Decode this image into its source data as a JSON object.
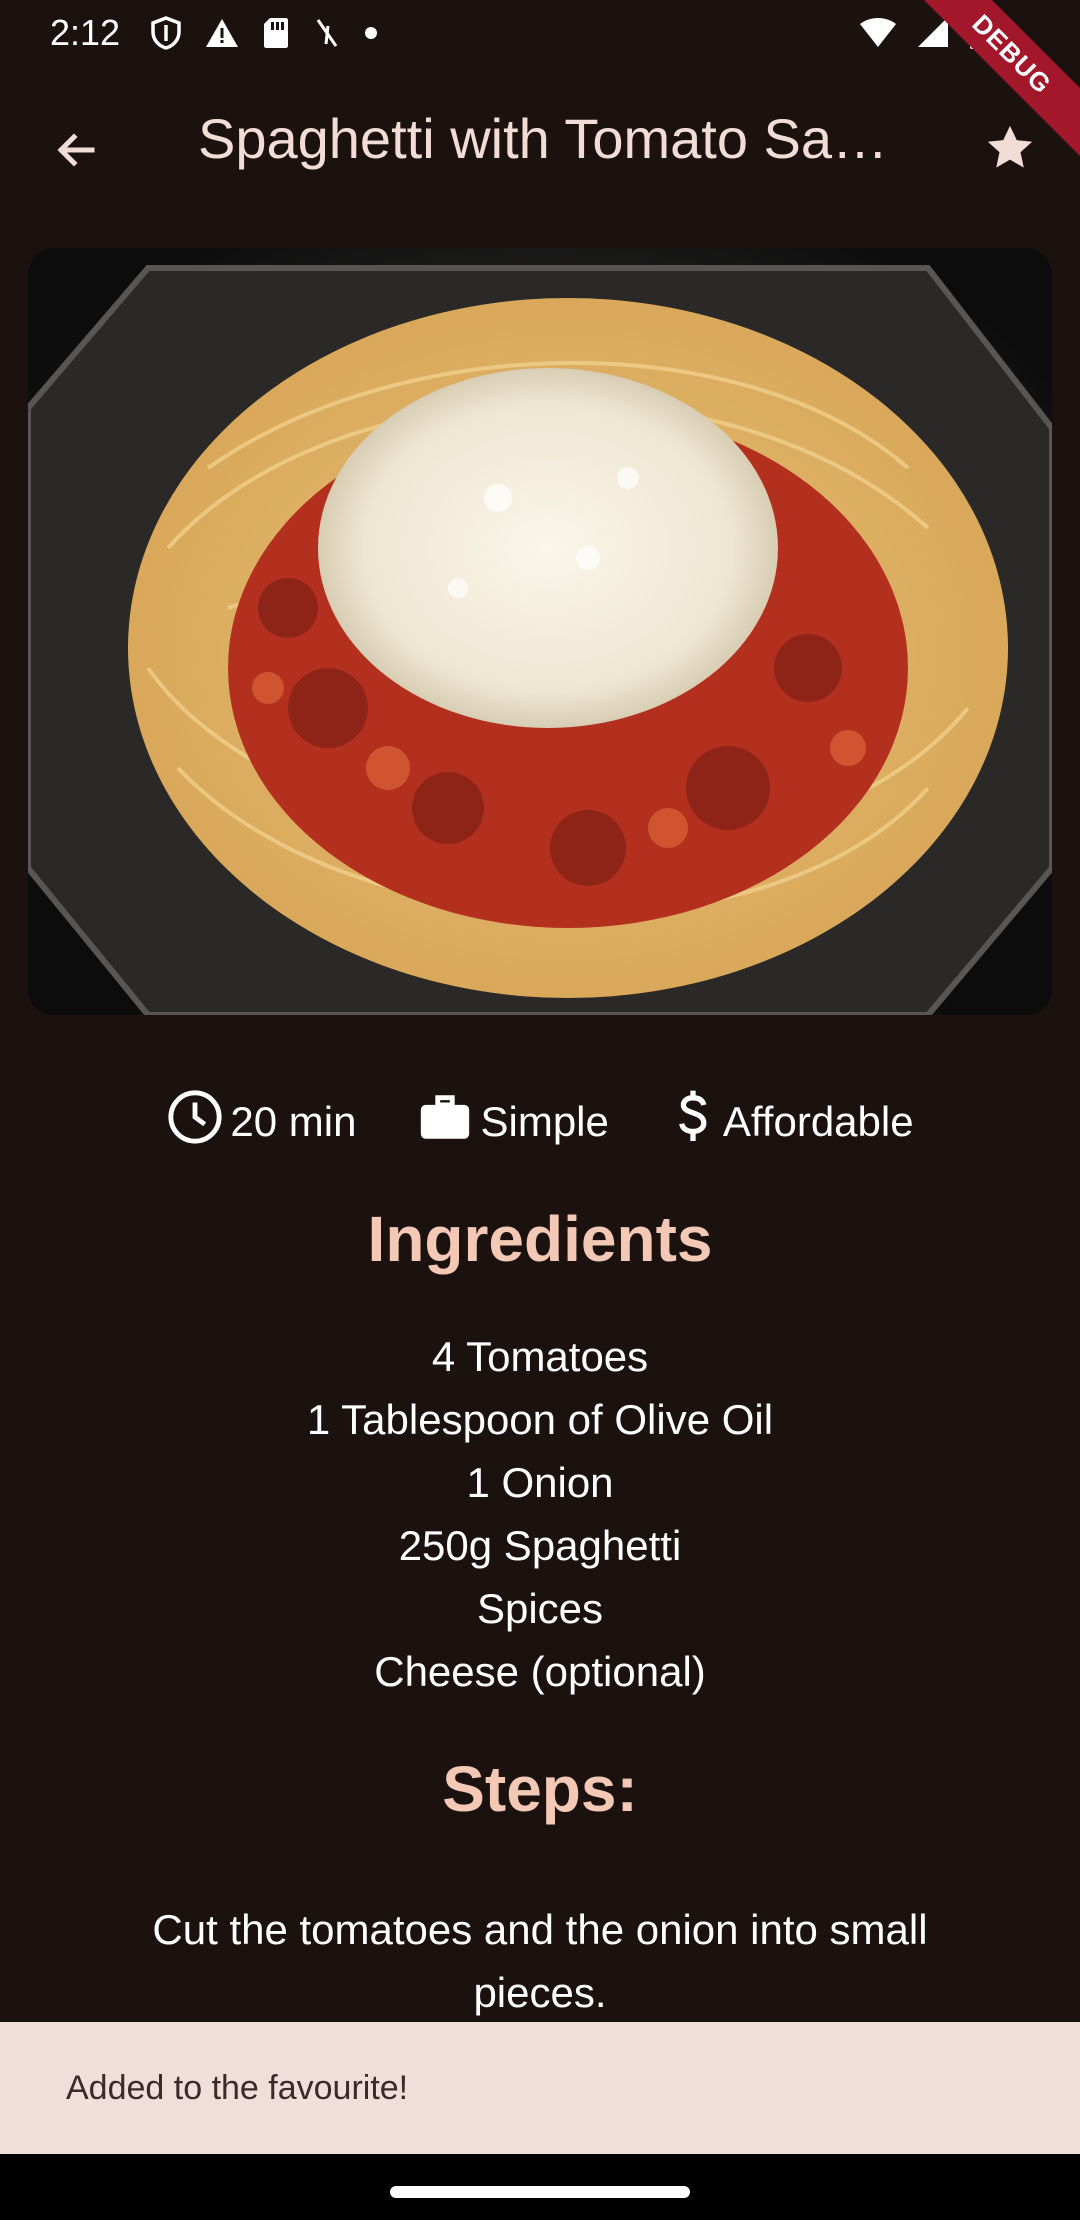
{
  "status_bar": {
    "time": "2:12",
    "left_icons": [
      "shield-icon",
      "warning-icon",
      "sim-card-icon",
      "signal-slash-icon",
      "dot-icon"
    ],
    "right_icons": [
      "wifi-icon",
      "cell-signal-icon",
      "battery-icon"
    ]
  },
  "debug_banner": "DEBUG",
  "app_bar": {
    "title": "Spaghetti with Tomato Sauce",
    "back_icon": "arrow-back-icon",
    "favorite_icon": "star-icon"
  },
  "recipe": {
    "image_subject": "Plate of spaghetti with tomato sauce and grated cheese",
    "duration": "20 min",
    "complexity": "Simple",
    "affordability": "Affordable",
    "ingredients_title": "Ingredients",
    "ingredients": [
      "4 Tomatoes",
      "1 Tablespoon of Olive Oil",
      "1 Onion",
      "250g Spaghetti",
      "Spices",
      "Cheese (optional)"
    ],
    "steps_title": "Steps:",
    "steps": [
      "Cut the tomatoes and the onion into small pieces."
    ]
  },
  "snackbar": {
    "message": "Added to the favourite!"
  },
  "colors": {
    "background": "#1b1210",
    "title_accent": "#f3c9b6",
    "snackbar_bg": "#f0dedb",
    "debug_banner": "#a3172b"
  }
}
